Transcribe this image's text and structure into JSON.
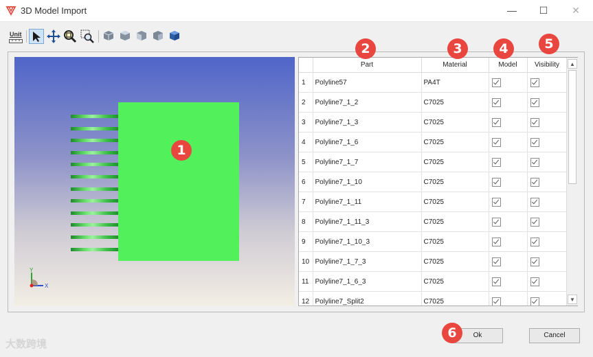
{
  "window": {
    "title": "3D Model Import",
    "min_glyph": "—",
    "max_glyph": "☐",
    "close_glyph": "✕"
  },
  "toolbar": {
    "unit_label": "Unit",
    "icons": [
      "unit-icon",
      "select-arrow-icon",
      "pan-move-icon",
      "zoom-fit-icon",
      "zoom-window-icon",
      "view-front-icon",
      "view-top-icon",
      "view-side-icon",
      "view-back-icon",
      "view-iso-icon"
    ]
  },
  "badges": [
    "1",
    "2",
    "3",
    "4",
    "5",
    "6"
  ],
  "viewport": {
    "axis_y": "Y",
    "axis_x": "X",
    "pin_count": 12
  },
  "table": {
    "columns": [
      "",
      "Part",
      "Material",
      "Model",
      "Visibility"
    ],
    "rows": [
      {
        "n": "1",
        "part": "Polyline57",
        "material": "PA4T",
        "model": true,
        "visible": true
      },
      {
        "n": "2",
        "part": "Polyline7_1_2",
        "material": "C7025",
        "model": true,
        "visible": true
      },
      {
        "n": "3",
        "part": "Polyline7_1_3",
        "material": "C7025",
        "model": true,
        "visible": true
      },
      {
        "n": "4",
        "part": "Polyline7_1_6",
        "material": "C7025",
        "model": true,
        "visible": true
      },
      {
        "n": "5",
        "part": "Polyline7_1_7",
        "material": "C7025",
        "model": true,
        "visible": true
      },
      {
        "n": "6",
        "part": "Polyline7_1_10",
        "material": "C7025",
        "model": true,
        "visible": true
      },
      {
        "n": "7",
        "part": "Polyline7_1_11",
        "material": "C7025",
        "model": true,
        "visible": true
      },
      {
        "n": "8",
        "part": "Polyline7_1_11_3",
        "material": "C7025",
        "model": true,
        "visible": true
      },
      {
        "n": "9",
        "part": "Polyline7_1_10_3",
        "material": "C7025",
        "model": true,
        "visible": true
      },
      {
        "n": "10",
        "part": "Polyline7_1_7_3",
        "material": "C7025",
        "model": true,
        "visible": true
      },
      {
        "n": "11",
        "part": "Polyline7_1_6_3",
        "material": "C7025",
        "model": true,
        "visible": true
      },
      {
        "n": "12",
        "part": "Polyline7_Split2",
        "material": "C7025",
        "model": true,
        "visible": true
      }
    ]
  },
  "scrollbar": {
    "up_glyph": "▲",
    "down_glyph": "▼"
  },
  "buttons": {
    "ok": "Ok",
    "cancel": "Cancel"
  },
  "watermark": "大数跨境"
}
